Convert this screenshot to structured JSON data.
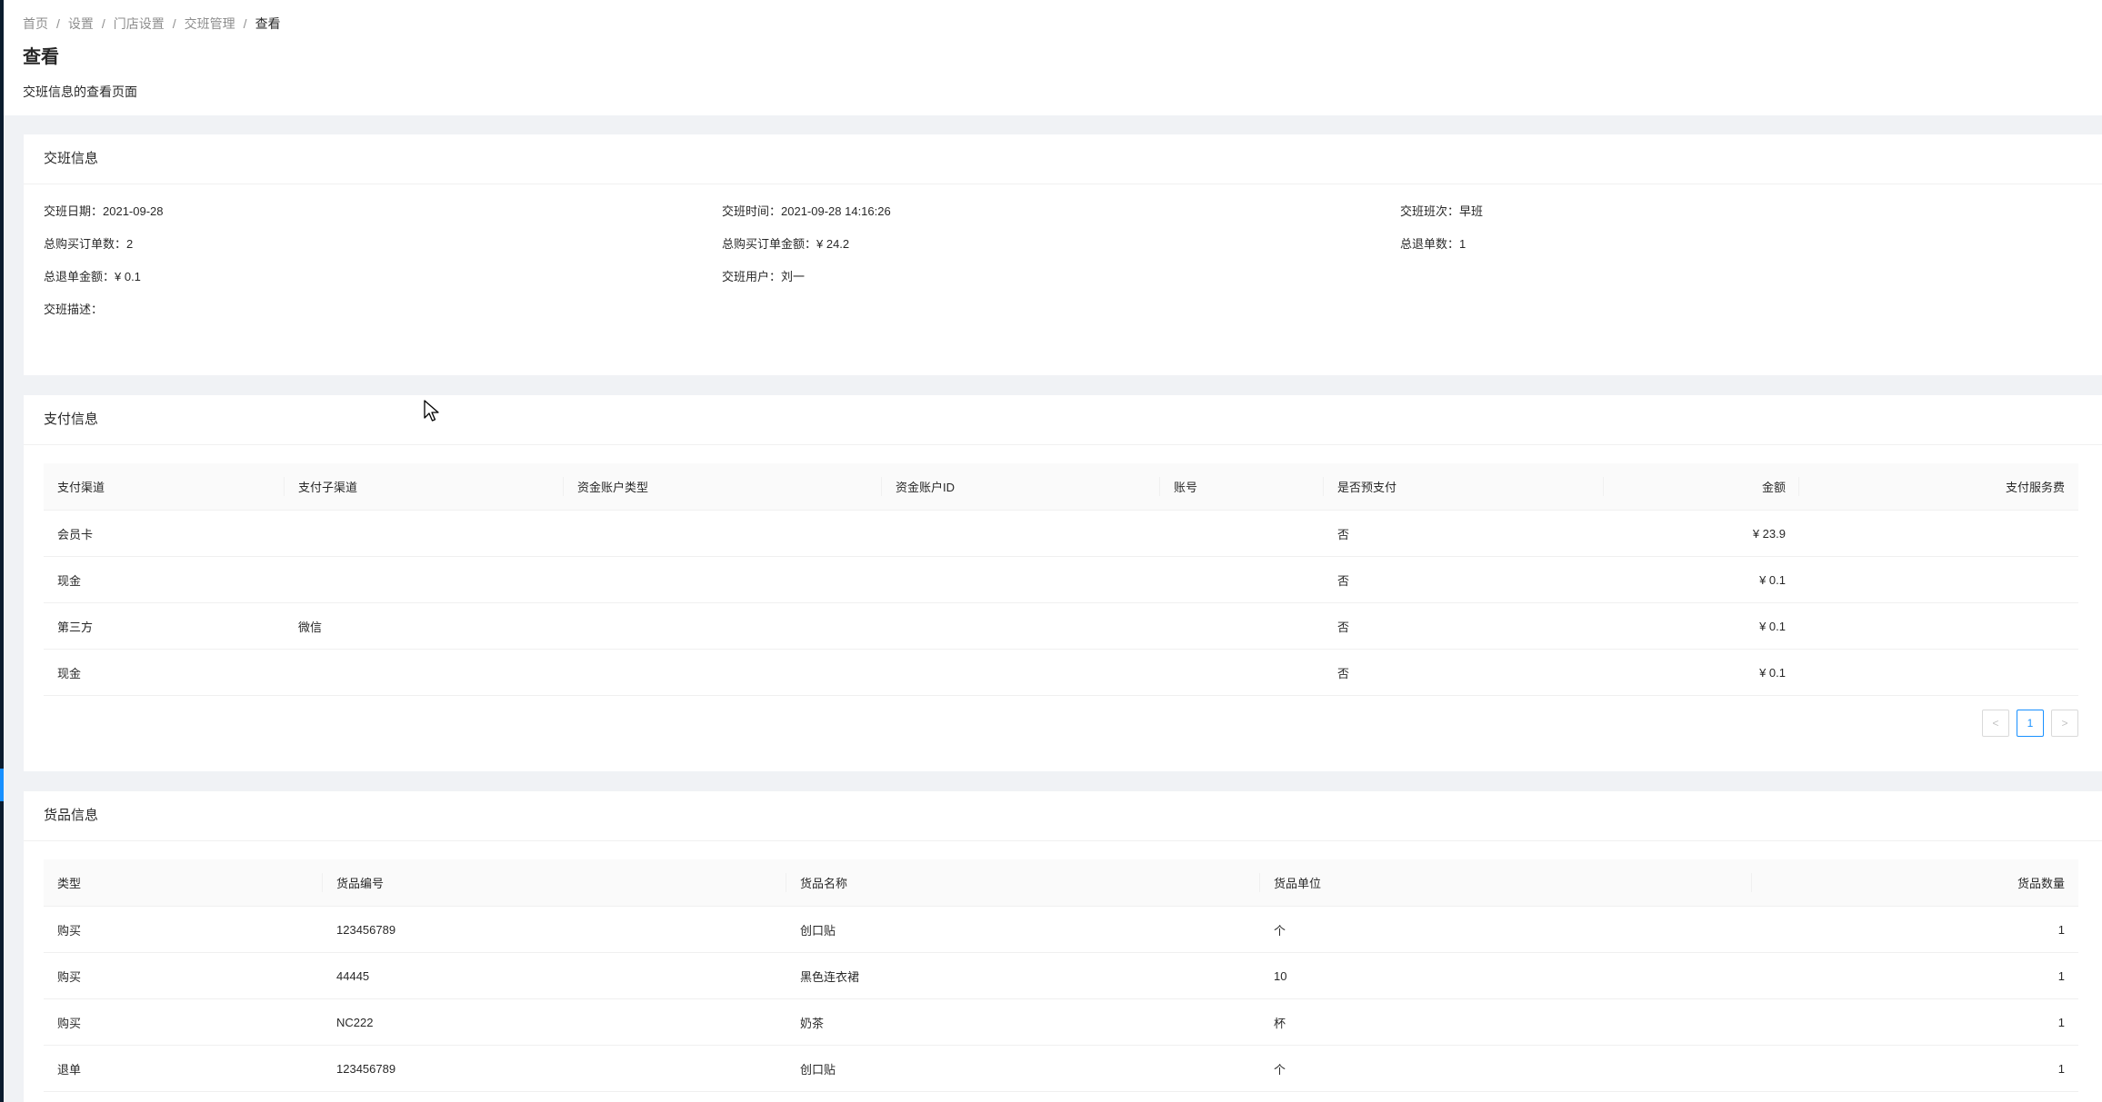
{
  "breadcrumb": {
    "items": [
      "首页",
      "设置",
      "门店设置",
      "交班管理"
    ],
    "current": "查看",
    "separator": "/"
  },
  "header": {
    "title": "查看",
    "description": "交班信息的查看页面"
  },
  "shift_info": {
    "title": "交班信息",
    "shift_date": "交班日期：2021-09-28",
    "shift_time": "交班时间：2021-09-28 14:16:26",
    "shift_period": "交班班次：早班",
    "total_orders": "总购买订单数：2",
    "total_order_amount": "总购买订单金额：¥ 24.2",
    "total_refunds": "总退单数：1",
    "total_refund_amount": "总退单金额：¥ 0.1",
    "shift_user": "交班用户：刘一",
    "shift_desc": "交班描述："
  },
  "payment_info": {
    "title": "支付信息",
    "columns": [
      "支付渠道",
      "支付子渠道",
      "资金账户类型",
      "资金账户ID",
      "账号",
      "是否预支付",
      "金额",
      "支付服务费"
    ],
    "rows": [
      {
        "channel": "会员卡",
        "sub_channel": "",
        "account_type": "",
        "account_id": "",
        "account_no": "",
        "prepaid": "否",
        "amount": "¥ 23.9",
        "fee": ""
      },
      {
        "channel": "现金",
        "sub_channel": "",
        "account_type": "",
        "account_id": "",
        "account_no": "",
        "prepaid": "否",
        "amount": "¥ 0.1",
        "fee": ""
      },
      {
        "channel": "第三方",
        "sub_channel": "微信",
        "account_type": "",
        "account_id": "",
        "account_no": "",
        "prepaid": "否",
        "amount": "¥ 0.1",
        "fee": ""
      },
      {
        "channel": "现金",
        "sub_channel": "",
        "account_type": "",
        "account_id": "",
        "account_no": "",
        "prepaid": "否",
        "amount": "¥ 0.1",
        "fee": ""
      }
    ],
    "pagination": {
      "prev": "<",
      "current_page": "1",
      "next": ">"
    }
  },
  "goods_info": {
    "title": "货品信息",
    "columns": [
      "类型",
      "货品编号",
      "货品名称",
      "货品单位",
      "货品数量"
    ],
    "rows": [
      {
        "type": "购买",
        "code": "123456789",
        "name": "创口贴",
        "unit": "个",
        "qty": "1"
      },
      {
        "type": "购买",
        "code": "44445",
        "name": "黑色连衣裙",
        "unit": "10",
        "qty": "1"
      },
      {
        "type": "购买",
        "code": "NC222",
        "name": "奶茶",
        "unit": "杯",
        "qty": "1"
      },
      {
        "type": "退单",
        "code": "123456789",
        "name": "创口贴",
        "unit": "个",
        "qty": "1"
      }
    ]
  },
  "colors": {
    "primary": "#1890ff",
    "background": "#f0f2f5",
    "sider": "#0b1c2e"
  },
  "icons": {
    "cursor": "arrow-cursor-icon"
  }
}
